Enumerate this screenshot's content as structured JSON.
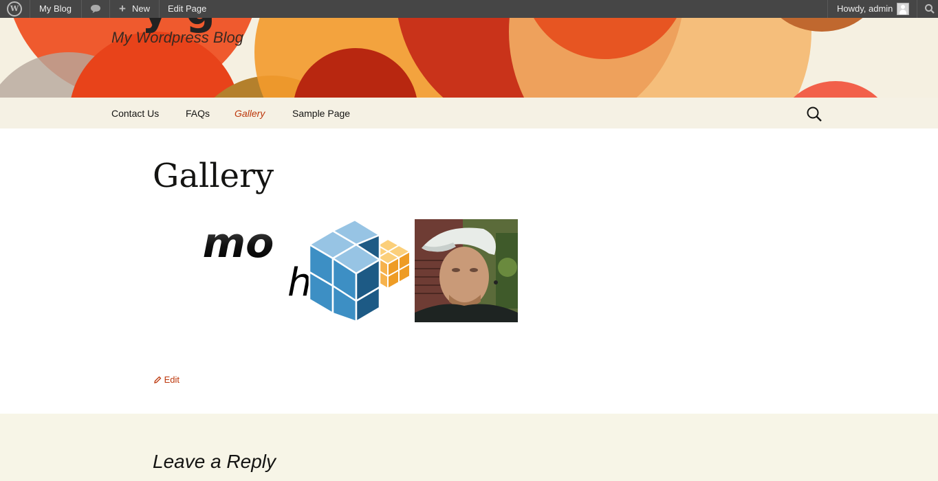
{
  "adminbar": {
    "site_name": "My Blog",
    "new_label": "New",
    "edit_label": "Edit Page",
    "howdy": "Howdy, admin"
  },
  "header": {
    "title_fragment": "y  g",
    "description": "My Wordpress Blog"
  },
  "nav": {
    "items": [
      {
        "label": "Contact Us"
      },
      {
        "label": "FAQs"
      },
      {
        "label": "Gallery"
      },
      {
        "label": "Sample Page"
      }
    ],
    "current_index": 2
  },
  "main": {
    "title": "Gallery",
    "logo_text_1": "imo",
    "logo_text_2": "h",
    "edit_label": "Edit"
  },
  "comments": {
    "reply_title": "Leave a Reply"
  },
  "colors": {
    "accent": "#bc360a",
    "admin_bar": "#464646",
    "header_bg": "#f5f0e1",
    "cube_blue": "#3d8fc4",
    "cube_dark": "#1d5a85",
    "cube_light": "#97c4e4",
    "cube_orange": "#f6b24c"
  }
}
